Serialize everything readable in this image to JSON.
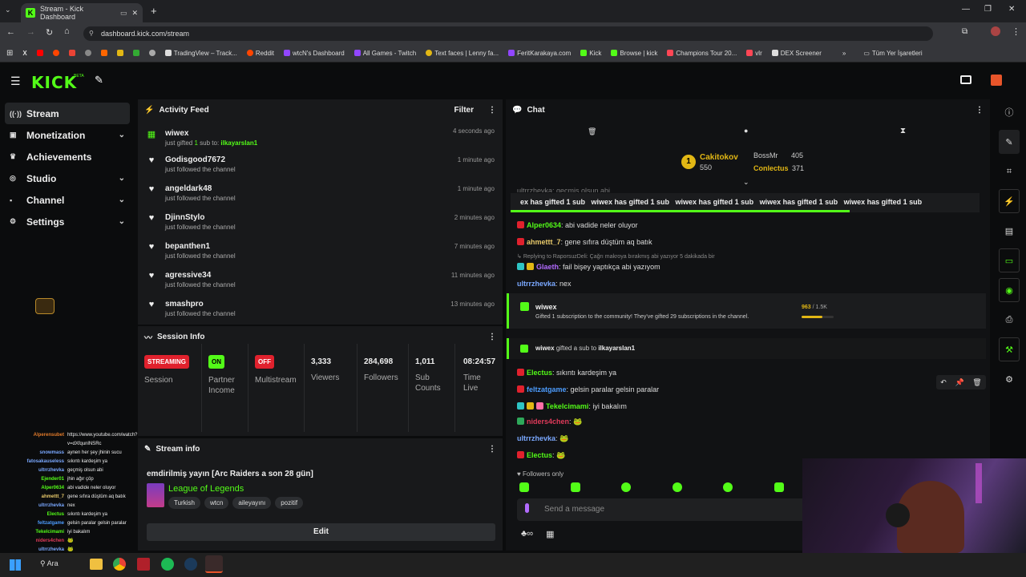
{
  "browser": {
    "tab_title": "Stream - Kick Dashboard",
    "url": "dashboard.kick.com/stream",
    "bookmarks": [
      "TradingView – Track...",
      "Reddit",
      "wtcN's Dashboard",
      "All Games - Twitch",
      "Text faces | Lenny fa...",
      "FeritKarakaya.com",
      "Kick",
      "Browse | kick",
      "Champions Tour 20...",
      "vlr",
      "DEX Screener"
    ],
    "bookmarks_folder": "Tüm Yer İşaretleri"
  },
  "brand": {
    "logo": "KICK",
    "beta": "BETA",
    "accent": "#53fc18"
  },
  "sidebar": {
    "items": [
      {
        "label": "Stream",
        "icon": "radio-icon",
        "glyph": "((·))",
        "active": true,
        "chevron": false
      },
      {
        "label": "Monetization",
        "icon": "money-icon",
        "glyph": "$",
        "active": false,
        "chevron": true
      },
      {
        "label": "Achievements",
        "icon": "trophy-icon",
        "glyph": "♛",
        "active": false,
        "chevron": false
      },
      {
        "label": "Studio",
        "icon": "studio-icon",
        "glyph": "◎",
        "active": false,
        "chevron": true
      },
      {
        "label": "Channel",
        "icon": "user-icon",
        "glyph": "●",
        "active": false,
        "chevron": true
      },
      {
        "label": "Settings",
        "icon": "gear-icon",
        "glyph": "⚙",
        "active": false,
        "chevron": true
      }
    ]
  },
  "activity": {
    "title": "Activity Feed",
    "filter": "Filter",
    "rows": [
      {
        "name": "wiwex",
        "sub_prefix": "just gifted ",
        "count": "1",
        "sub_mid": " sub to: ",
        "target": "ilkayarslan1",
        "time": "4 seconds ago",
        "icon": "gift-icon"
      },
      {
        "name": "Godisgood7672",
        "sub": "just followed the channel",
        "time": "1 minute ago",
        "icon": "heart-icon"
      },
      {
        "name": "angeldark48",
        "sub": "just followed the channel",
        "time": "1 minute ago",
        "icon": "heart-icon"
      },
      {
        "name": "DjinnStylo",
        "sub": "just followed the channel",
        "time": "2 minutes ago",
        "icon": "heart-icon"
      },
      {
        "name": "bepanthen1",
        "sub": "just followed the channel",
        "time": "7 minutes ago",
        "icon": "heart-icon"
      },
      {
        "name": "agressive34",
        "sub": "just followed the channel",
        "time": "11 minutes ago",
        "icon": "heart-icon"
      },
      {
        "name": "smashpro",
        "sub": "just followed the channel",
        "time": "13 minutes ago",
        "icon": "heart-icon"
      }
    ]
  },
  "session": {
    "title": "Session Info",
    "cols": [
      {
        "badge": "STREAMING",
        "badge_color": "#e0212d",
        "label": "Session"
      },
      {
        "badge": "ON",
        "badge_color": "#53fc18",
        "label": "Partner Income"
      },
      {
        "badge": "OFF",
        "badge_color": "#e0212d",
        "label": "Multistream"
      },
      {
        "value": "3,333",
        "label": "Viewers"
      },
      {
        "value": "284,698",
        "label": "Followers"
      },
      {
        "value": "1,011",
        "label": "Sub Counts"
      },
      {
        "value": "08:24:57",
        "label": "Time Live"
      }
    ]
  },
  "stream_info": {
    "title": "Stream info",
    "stream_title": "emdirilmiş yayın [Arc Raiders a son 28 gün]",
    "category": "League of Legends",
    "tags": [
      "Turkish",
      "wtcn",
      "aileyayını",
      "pozitif"
    ],
    "edit": "Edit"
  },
  "chat": {
    "title": "Chat",
    "leaderboard": {
      "first": {
        "rank": "1",
        "name": "Cakitokov",
        "value": "550"
      },
      "second": {
        "name": "BossMr",
        "value": "405"
      },
      "third": {
        "name": "Conlectus",
        "value": "371"
      }
    },
    "cutoff": "ultrrzhevka: geçmiş olsun abi",
    "ticker": "ex has gifted 1 sub   wiwex has gifted 1 sub   wiwex has gifted 1 sub   wiwex has gifted 1 sub   wiwex has gifted 1 sub",
    "messages": [
      {
        "user": "Alper0634",
        "color": "#53fc18",
        "text": "abi vadide neler oluyor"
      },
      {
        "user": "ahmettt_7",
        "color": "#e8c96a",
        "text": "gene sıfıra düştüm aq batık"
      },
      {
        "reply": "Replying to RaporsuzDeli: Çağrı makroya bırakmış abi yazıyor 5 dakikada bir"
      },
      {
        "user": "Glaeth",
        "color": "#b26bff",
        "text": "fail bişey yaptıkça abi yazıyom"
      },
      {
        "user": "ultrrzhevka",
        "color": "#7aa8ff",
        "text": "nex"
      }
    ],
    "gift_card": {
      "user": "wiwex",
      "text": "Gifted 1 subscription to the community! They've gifted 29 subscriptions in the channel.",
      "progress_text": "963",
      "progress_max": "/ 1.5K",
      "progress": 0.642
    },
    "gift_line": {
      "user": "wiwex",
      "mid": "gifted a sub to",
      "target": "ilkayarslan1"
    },
    "messages2": [
      {
        "user": "Electus",
        "color": "#53fc18",
        "text": "sıkıntı kardeşim ya"
      },
      {
        "user": "feltzatgame",
        "color": "#4d9dff",
        "text": "gelsin paralar gelsin paralar"
      },
      {
        "user": "Tekelcimami",
        "color": "#53fc18",
        "text": "iyi bakalım"
      },
      {
        "user": "niders4chen",
        "color": "#e03a5a",
        "text": "🐸"
      },
      {
        "user": "ultrrzhevka",
        "color": "#7aa8ff",
        "text": "🐸"
      },
      {
        "user": "Electus",
        "color": "#53fc18",
        "text": "🐸"
      }
    ],
    "followers_only": "Followers only",
    "placeholder": "Send a message"
  },
  "overlay_chat": [
    {
      "u": "Alperensubet",
      "c": "#e07a2a",
      "t": "https://www.youtube.com/watch?"
    },
    {
      "u": "",
      "c": "#fff",
      "t": "v=dXfqunlNSRc"
    },
    {
      "u": "snowmass",
      "c": "#7aa8ff",
      "t": "aynen her şey jhinin sucu"
    },
    {
      "u": "fatosakauseless",
      "c": "#7aa8ff",
      "t": "sıkıntı kardeşim ya"
    },
    {
      "u": "ultrrzhevka",
      "c": "#7aa8ff",
      "t": "geçmiş olsun abi"
    },
    {
      "u": "Ejender01",
      "c": "#53fc18",
      "t": "jhin ağır çöp"
    },
    {
      "u": "Alper0634",
      "c": "#53fc18",
      "t": "abi vadide neler oluyor"
    },
    {
      "u": "ahmettt_7",
      "c": "#e8c96a",
      "t": "gene sıfıra düştüm aq batık"
    },
    {
      "u": "ultrrzhevka",
      "c": "#7aa8ff",
      "t": "nex"
    },
    {
      "u": "Electus",
      "c": "#53fc18",
      "t": "sıkıntı kardeşim ya"
    },
    {
      "u": "feltzatgame",
      "c": "#4d9dff",
      "t": "gelsin paralar gelsin paralar"
    },
    {
      "u": "Tekelcimami",
      "c": "#53fc18",
      "t": "iyi bakalım"
    },
    {
      "u": "niders4chen",
      "c": "#e03a5a",
      "t": "🐸"
    },
    {
      "u": "ultrrzhevka",
      "c": "#7aa8ff",
      "t": "🐸"
    }
  ],
  "taskbar": {
    "search": "Ara"
  }
}
